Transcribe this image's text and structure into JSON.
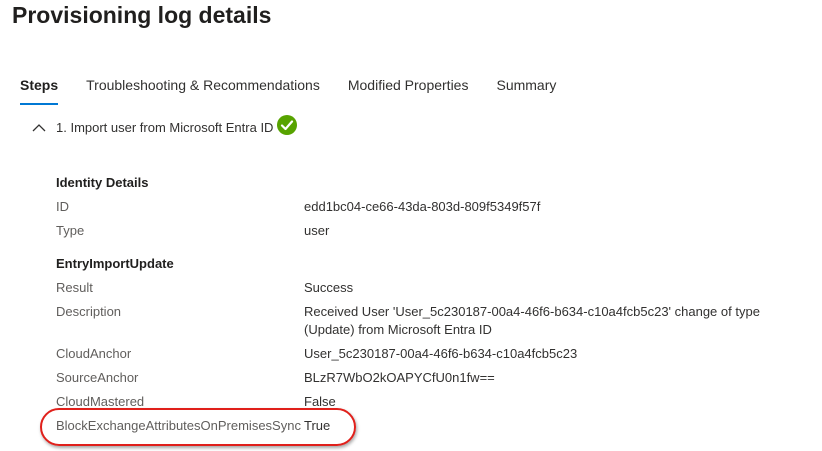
{
  "page": {
    "title": "Provisioning log details"
  },
  "tabs": [
    {
      "label": "Steps",
      "active": true
    },
    {
      "label": "Troubleshooting & Recommendations",
      "active": false
    },
    {
      "label": "Modified Properties",
      "active": false
    },
    {
      "label": "Summary",
      "active": false
    }
  ],
  "step": {
    "label": "1. Import user from Microsoft Entra ID",
    "expanded": true,
    "status_icon": "check-circle-icon",
    "status_color": "#57a300"
  },
  "identity_details": {
    "title": "Identity Details",
    "rows": [
      {
        "label": "ID",
        "value": "edd1bc04-ce66-43da-803d-809f5349f57f"
      },
      {
        "label": "Type",
        "value": "user"
      }
    ]
  },
  "entry_import_update": {
    "title": "EntryImportUpdate",
    "rows": [
      {
        "label": "Result",
        "value": "Success"
      },
      {
        "label": "Description",
        "value": "Received User 'User_5c230187-00a4-46f6-b634-c10a4fcb5c23' change of type (Update) from Microsoft Entra ID"
      },
      {
        "label": "CloudAnchor",
        "value": "User_5c230187-00a4-46f6-b634-c10a4fcb5c23"
      },
      {
        "label": "SourceAnchor",
        "value": "BLzR7WbO2kOAPYCfU0n1fw=="
      },
      {
        "label": "CloudMastered",
        "value": "False"
      },
      {
        "label": "BlockExchangeAttributesOnPremisesSync",
        "value": "True"
      }
    ]
  },
  "colors": {
    "accent": "#0078d4",
    "highlight": "#e0201b"
  }
}
